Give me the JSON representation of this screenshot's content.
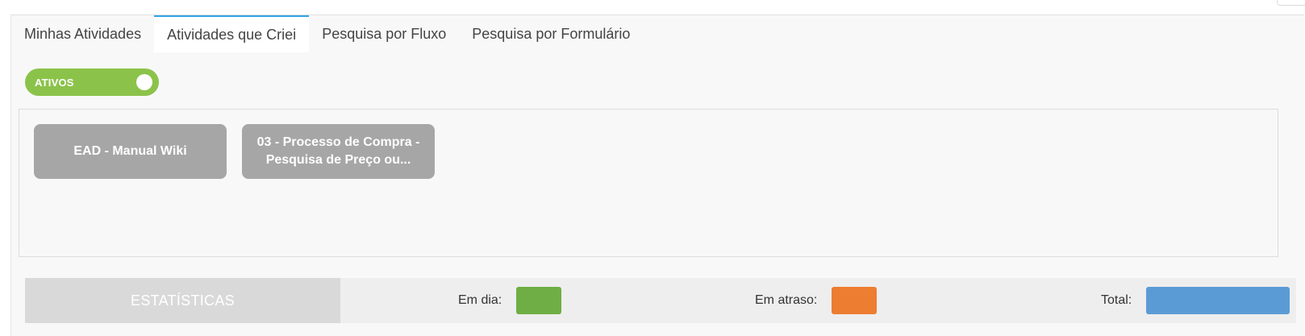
{
  "tabs": [
    {
      "label": "Minhas Atividades",
      "active": false
    },
    {
      "label": "Atividades que Criei",
      "active": true
    },
    {
      "label": "Pesquisa por Fluxo",
      "active": false
    },
    {
      "label": "Pesquisa por Formulário",
      "active": false
    }
  ],
  "toggle": {
    "label": "ATIVOS",
    "state": "on"
  },
  "cards": [
    {
      "title": "EAD - Manual Wiki"
    },
    {
      "title": "03 - Processo de Compra - Pesquisa de Preço ou..."
    }
  ],
  "stats": {
    "title": "ESTATÍSTICAS",
    "em_dia_label": "Em dia:",
    "em_atraso_label": "Em atraso:",
    "total_label": "Total:"
  },
  "colors": {
    "accent_tab": "#2fa4e7",
    "toggle_on": "#8bc34a",
    "card_bg": "#a6a6a6",
    "em_dia": "#6fae44",
    "em_atraso": "#ed7d31",
    "total": "#5b9bd5"
  }
}
